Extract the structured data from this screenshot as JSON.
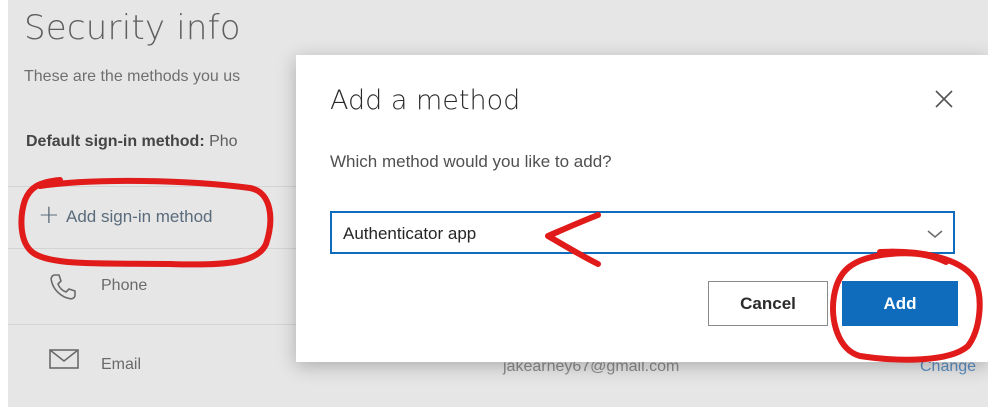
{
  "background_page": {
    "title": "Security info",
    "subtitle": "These are the methods you us",
    "default_method_label": "Default sign-in method:",
    "default_method_value": "Pho",
    "add_method_label": "Add sign-in method",
    "methods": [
      {
        "label": "Phone",
        "icon": "phone-icon"
      },
      {
        "label": "Email",
        "icon": "envelope-icon",
        "detail": "jakearney67@gmail.com",
        "action": "Change"
      }
    ]
  },
  "modal": {
    "title": "Add a method",
    "prompt": "Which method would you like to add?",
    "selected_method": "Authenticator app",
    "cancel_label": "Cancel",
    "add_label": "Add",
    "close_icon": "close-icon",
    "dropdown_icon": "chevron-down-icon"
  },
  "colors": {
    "primary": "#0f6cbd",
    "annotation": "#e11a1a",
    "overlay": "#e6e6e6"
  }
}
